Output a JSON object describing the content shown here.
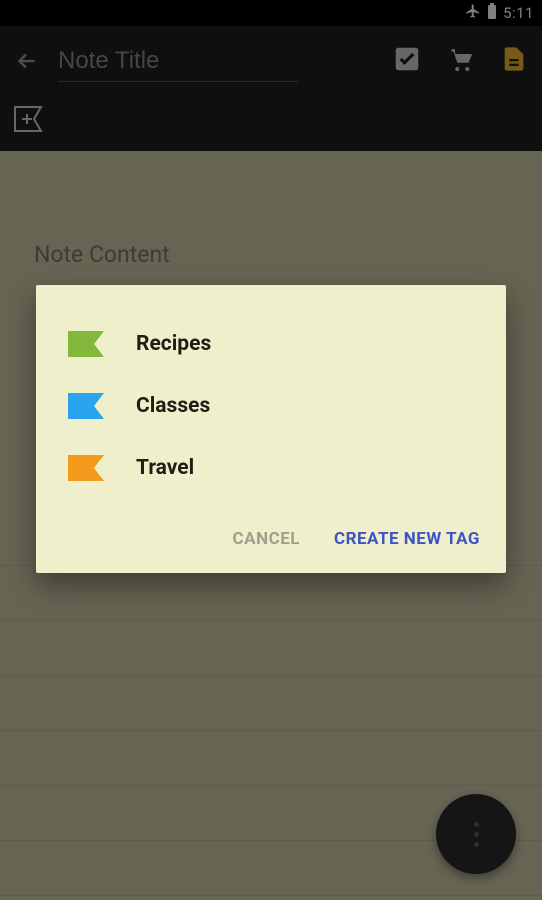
{
  "status": {
    "time": "5:11"
  },
  "header": {
    "title_placeholder": "Note Title"
  },
  "note": {
    "content_placeholder": "Note Content"
  },
  "dialog": {
    "tags": [
      {
        "label": "Recipes",
        "color": "#84b83a"
      },
      {
        "label": "Classes",
        "color": "#2aa3f0"
      },
      {
        "label": "Travel",
        "color": "#f59b1c"
      }
    ],
    "cancel_label": "CANCEL",
    "create_label": "CREATE NEW TAG"
  }
}
